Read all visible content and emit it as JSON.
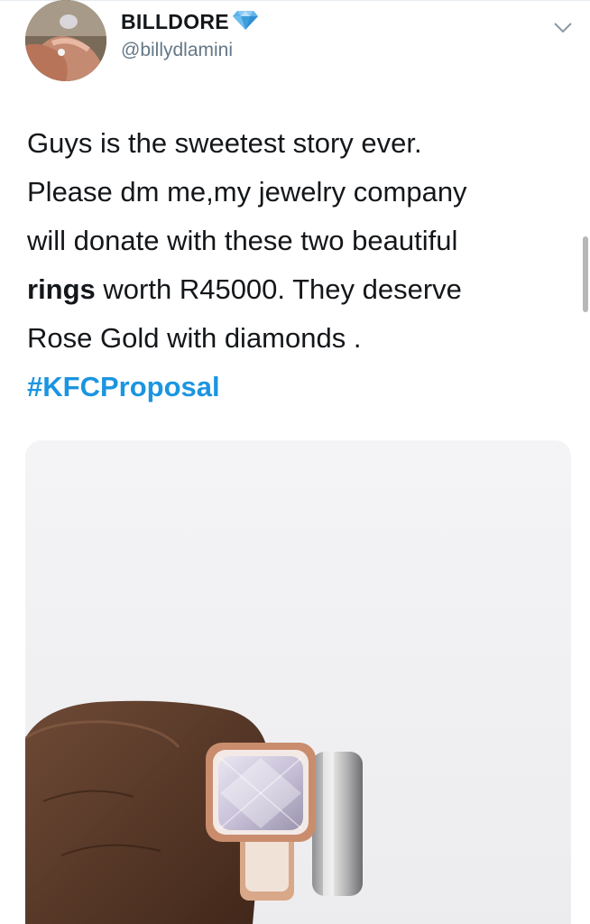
{
  "author": {
    "display_name": "BILLDORE",
    "handle": "@billydlamini",
    "verified_emoji": "diamond-icon"
  },
  "tweet": {
    "line1": "Guys is the sweetest story ever.",
    "line2": "Please dm me,my jewelry company",
    "line3": "will donate with these two beautiful",
    "line4_bold": "rings",
    "line4_rest": " worth R45000. They deserve",
    "line5": "Rose Gold with diamonds .",
    "hashtag": "#KFCProposal"
  },
  "media": {
    "description_icon": "ring-photo"
  },
  "colors": {
    "hashtag": "#1b95e0",
    "text": "#14171a",
    "secondary": "#657786",
    "diamond": "#4aa3df"
  }
}
